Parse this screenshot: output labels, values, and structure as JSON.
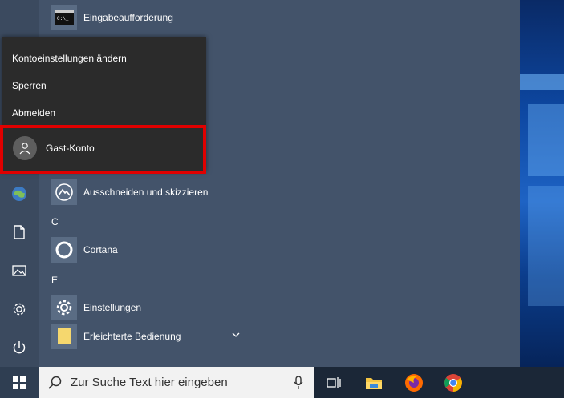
{
  "apps": {
    "cmd_label": "Eingabeaufforderung",
    "snip_label": "Ausschneiden und skizzieren",
    "cortana_label": "Cortana",
    "settings_label": "Einstellungen",
    "ease_label": "Erleichterte Bedienung"
  },
  "sections": {
    "c": "C",
    "e": "E"
  },
  "account_menu": {
    "change_settings": "Kontoeinstellungen ändern",
    "lock": "Sperren",
    "sign_out": "Abmelden",
    "guest": "Gast-Konto"
  },
  "taskbar": {
    "search_placeholder": "Zur Suche Text hier eingeben"
  },
  "colors": {
    "highlight": "#e00000",
    "accent": "#0d47a1"
  }
}
